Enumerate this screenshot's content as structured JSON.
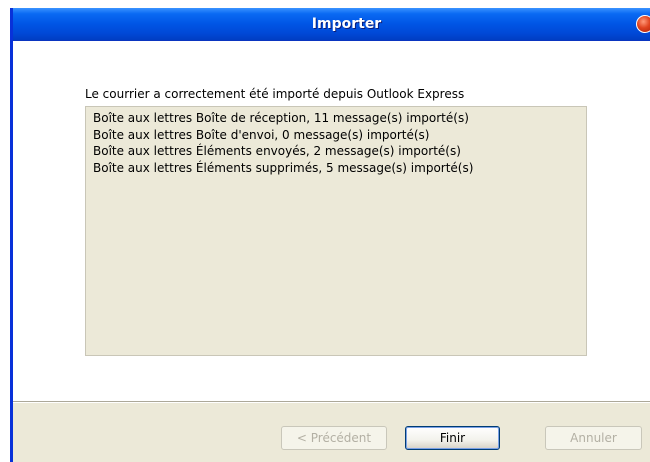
{
  "window": {
    "title": "Importer"
  },
  "main": {
    "status_message": "Le courrier a correctement été importé depuis Outlook Express",
    "log_lines": [
      "Boîte aux lettres Boîte de réception, 11 message(s) importé(s)",
      "Boîte aux lettres Boîte d'envoi, 0 message(s) importé(s)",
      "Boîte aux lettres Éléments envoyés, 2 message(s) importé(s)",
      "Boîte aux lettres Éléments supprimés, 5 message(s) importé(s)"
    ]
  },
  "buttons": {
    "previous_label": "< Précédent",
    "finish_label": "Finir",
    "cancel_label": "Annuler"
  },
  "colors": {
    "titlebar": "#0055e5",
    "dialog_bg": "#ece9d8",
    "disabled_text": "#b3b0a4"
  },
  "icons": {
    "close": "close-icon"
  }
}
